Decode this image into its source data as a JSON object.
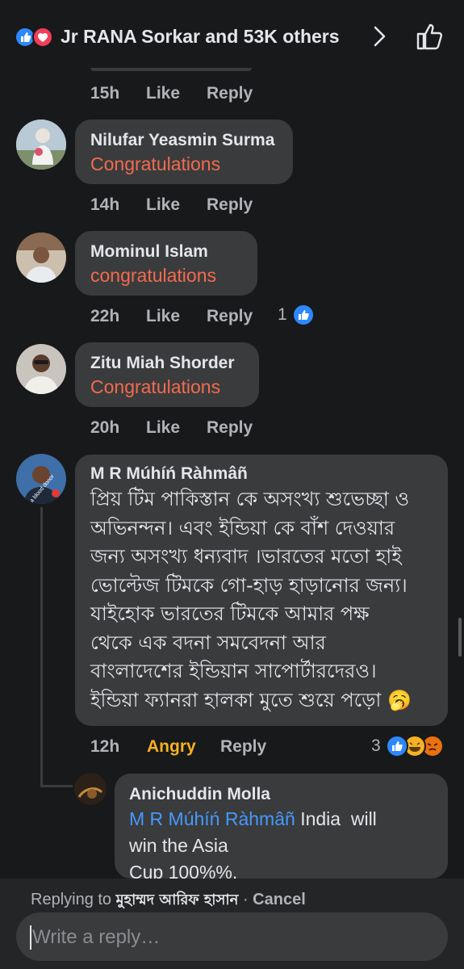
{
  "header": {
    "reactors_text": "Jr  RANA Sorkar and 53K others"
  },
  "comments": [
    {
      "time": "15h",
      "like": "Like",
      "reply": "Reply"
    },
    {
      "name": "Nilufar Yeasmin Surma",
      "text": "Congratulations",
      "time": "14h",
      "like": "Like",
      "reply": "Reply"
    },
    {
      "name": "Mominul Islam",
      "text": "congratulations",
      "time": "22h",
      "like": "Like",
      "reply": "Reply",
      "reaction_count": "1"
    },
    {
      "name": "Zitu Miah Shorder",
      "text": "Congratulations",
      "time": "20h",
      "like": "Like",
      "reply": "Reply"
    },
    {
      "name": "M R Múhíń Ràhmâñ",
      "lines": [
        "প্রিয় টিম পাকিস্তান কে অসংখ্য শুভেচ্ছা ও",
        "অভিনন্দন। এবং ইন্ডিয়া কে বাঁশ দেওয়ার",
        "জন্য অসংখ্য ধন্যবাদ ।ভারতের মতো হাই",
        "ভোল্টেজ টিমকে গো-হাড় হাড়ানোর জন্য।",
        "যাইহোক ভারতের টিমকে আমার পক্ষ",
        "থেকে এক বদনা সমবেদনা আর",
        "বাংলাদেশের ইন্ডিয়ান সাপোর্টারদেরও।",
        "ইন্ডিয়া ফ্যানরা হালকা মুতে শুয়ে পড়ো 🥱"
      ],
      "time": "12h",
      "reaction_label": "Angry",
      "reply": "Reply",
      "reaction_count": "3",
      "avatar_badge": "I'm a blood donor"
    },
    {
      "name": "Anichuddin Molla",
      "mention": "M R Múhíń Ràhmâñ",
      "text_line1": " India  will",
      "text_line2": "win the Asia",
      "text_line3": "Cup 100%%."
    }
  ],
  "reply_bar": {
    "prefix": "Replying to ",
    "target": "মুহাম্মদ আরিফ হাসান",
    "separator": " · ",
    "cancel": "Cancel",
    "placeholder": "Write a reply…"
  },
  "colors": {
    "background": "#18191a",
    "bubble": "#3a3b3c",
    "comment_text": "#f26b4f",
    "angry": "#f7b125",
    "mention": "#4599ff",
    "like_blue": "#2d88ff",
    "love_red": "#f33e58"
  }
}
